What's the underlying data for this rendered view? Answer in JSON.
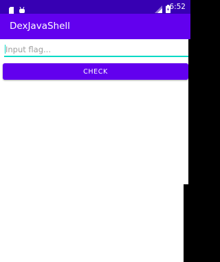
{
  "status_bar": {
    "time": "6:52",
    "left_icons": [
      "sd-card-icon",
      "android-debug-icon"
    ],
    "right_icons": [
      "signal-icon",
      "battery-icon"
    ],
    "color": "#3700B3"
  },
  "app_bar": {
    "title": "DexJavaShell",
    "color": "#6200EE"
  },
  "form": {
    "input_placeholder": "Input flag...",
    "input_value": "",
    "input_accent_color": "#03DAC5",
    "check_label": "CHECK",
    "button_color": "#6200EE"
  }
}
